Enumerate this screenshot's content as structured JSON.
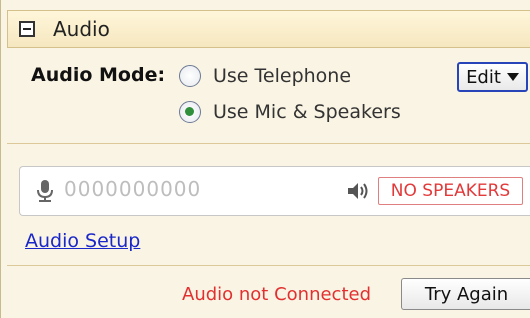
{
  "header": {
    "title": "Audio",
    "collapse_icon": "minus-square-icon"
  },
  "audio_mode": {
    "label": "Audio Mode:",
    "options": [
      {
        "label": "Use Telephone",
        "selected": false
      },
      {
        "label": "Use Mic & Speakers",
        "selected": true
      }
    ]
  },
  "edit_button": {
    "label": "Edit",
    "icon": "chevron-down-icon"
  },
  "devices": {
    "mic_icon": "microphone-icon",
    "mic_level": "0000000000",
    "speaker_icon": "speaker-icon",
    "speaker_status": "NO SPEAKERS"
  },
  "audio_setup": {
    "label": "Audio Setup"
  },
  "footer": {
    "status": "Audio not Connected",
    "try_again_label": "Try Again"
  },
  "colors": {
    "panel_bg": "#faf4e4",
    "error_red": "#e23a3a",
    "link_blue": "#1a27c9",
    "radio_selected": "#2f8f3b",
    "edit_border": "#2745b8"
  }
}
